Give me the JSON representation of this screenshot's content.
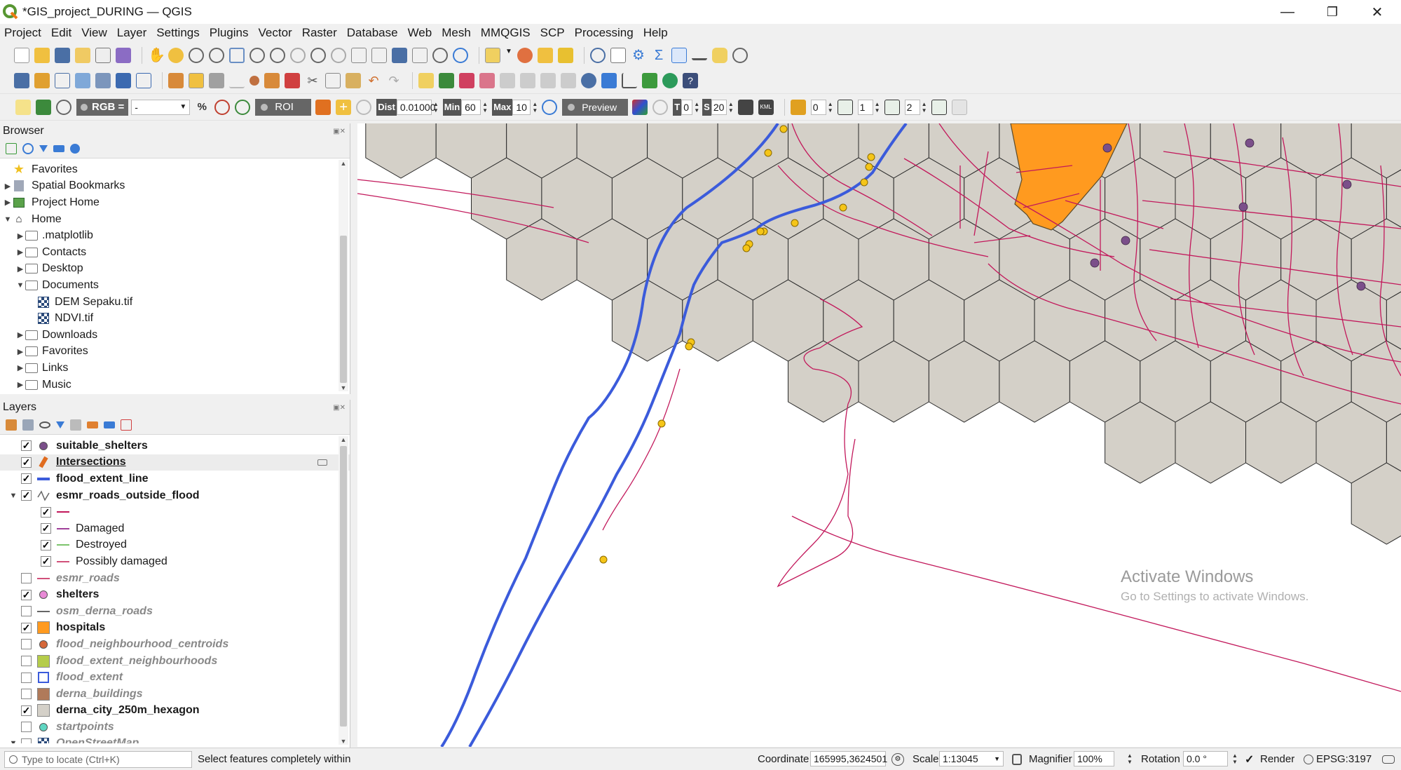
{
  "window": {
    "title": "*GIS_project_DURING — QGIS",
    "minimize": "—",
    "maximize": "❐",
    "close": "✕"
  },
  "menu": [
    "Project",
    "Edit",
    "View",
    "Layer",
    "Settings",
    "Plugins",
    "Vector",
    "Raster",
    "Database",
    "Web",
    "Mesh",
    "MMQGIS",
    "SCP",
    "Processing",
    "Help"
  ],
  "scp_toolbar": {
    "rgb_label": "RGB =",
    "rgb_value": "-",
    "roi_label": "ROI",
    "dist_label": "Dist",
    "dist_value": "0.01000",
    "min_label": "Min",
    "min_value": "60",
    "max_label": "Max",
    "max_value": "10",
    "preview_label": "Preview",
    "t_label": "T",
    "t_value": "0",
    "s_label": "S",
    "s_value": "20",
    "band_values": [
      "0",
      "1",
      "2"
    ]
  },
  "browser": {
    "title": "Browser",
    "items": [
      {
        "label": "Favorites",
        "level": 0,
        "arrow": "",
        "icon": "star"
      },
      {
        "label": "Spatial Bookmarks",
        "level": 0,
        "arrow": "▶",
        "icon": "bookmark"
      },
      {
        "label": "Project Home",
        "level": 0,
        "arrow": "▶",
        "icon": "project-home"
      },
      {
        "label": "Home",
        "level": 0,
        "arrow": "▼",
        "icon": "home"
      },
      {
        "label": ".matplotlib",
        "level": 1,
        "arrow": "▶",
        "icon": "folder"
      },
      {
        "label": "Contacts",
        "level": 1,
        "arrow": "▶",
        "icon": "folder"
      },
      {
        "label": "Desktop",
        "level": 1,
        "arrow": "▶",
        "icon": "folder"
      },
      {
        "label": "Documents",
        "level": 1,
        "arrow": "▼",
        "icon": "folder"
      },
      {
        "label": "DEM Sepaku.tif",
        "level": 2,
        "arrow": "",
        "icon": "raster"
      },
      {
        "label": "NDVI.tif",
        "level": 2,
        "arrow": "",
        "icon": "raster"
      },
      {
        "label": "Downloads",
        "level": 1,
        "arrow": "▶",
        "icon": "folder"
      },
      {
        "label": "Favorites",
        "level": 1,
        "arrow": "▶",
        "icon": "folder"
      },
      {
        "label": "Links",
        "level": 1,
        "arrow": "▶",
        "icon": "folder"
      },
      {
        "label": "Music",
        "level": 1,
        "arrow": "▶",
        "icon": "folder"
      }
    ]
  },
  "layers": {
    "title": "Layers",
    "items": [
      {
        "label": "suitable_shelters",
        "checked": true,
        "style": "bold",
        "symbol": "dot",
        "color": "#7b4f8a",
        "level": 0,
        "arrow": ""
      },
      {
        "label": "Intersections",
        "checked": true,
        "style": "bold-underline",
        "symbol": "brush",
        "color": "#e06c1f",
        "level": 0,
        "arrow": ""
      },
      {
        "label": "flood_extent_line",
        "checked": true,
        "style": "bold",
        "symbol": "line",
        "color": "#3b5bdb",
        "level": 0,
        "arrow": ""
      },
      {
        "label": "esmr_roads_outside_flood",
        "checked": true,
        "style": "bold",
        "symbol": "linestring",
        "color": "#777777",
        "level": 0,
        "arrow": "▼"
      },
      {
        "label": "",
        "checked": true,
        "style": "normal",
        "symbol": "line",
        "color": "#c2185b",
        "level": 1,
        "arrow": ""
      },
      {
        "label": "Damaged",
        "checked": true,
        "style": "normal",
        "symbol": "line",
        "color": "#a0409a",
        "level": 1,
        "arrow": ""
      },
      {
        "label": "Destroyed",
        "checked": true,
        "style": "normal",
        "symbol": "line",
        "color": "#7cc46c",
        "level": 1,
        "arrow": ""
      },
      {
        "label": "Possibly damaged",
        "checked": true,
        "style": "normal",
        "symbol": "line",
        "color": "#d1507a",
        "level": 1,
        "arrow": ""
      },
      {
        "label": "esmr_roads",
        "checked": false,
        "style": "off",
        "symbol": "line",
        "color": "#d1507a",
        "level": 0,
        "arrow": ""
      },
      {
        "label": "shelters",
        "checked": true,
        "style": "bold",
        "symbol": "dot",
        "color": "#e88ad6",
        "level": 0,
        "arrow": ""
      },
      {
        "label": "osm_derna_roads",
        "checked": false,
        "style": "off",
        "symbol": "line",
        "color": "#666666",
        "level": 0,
        "arrow": ""
      },
      {
        "label": "hospitals",
        "checked": true,
        "style": "bold",
        "symbol": "fill",
        "color": "#ff9a1f",
        "level": 0,
        "arrow": ""
      },
      {
        "label": "flood_neighbourhood_centroids",
        "checked": false,
        "style": "off",
        "symbol": "dot",
        "color": "#d6683a",
        "level": 0,
        "arrow": ""
      },
      {
        "label": "flood_extent_neighbourhoods",
        "checked": false,
        "style": "off",
        "symbol": "fill",
        "color": "#b5cc4a",
        "level": 0,
        "arrow": ""
      },
      {
        "label": "flood_extent",
        "checked": false,
        "style": "off",
        "symbol": "outline",
        "color": "#3b5bdb",
        "level": 0,
        "arrow": ""
      },
      {
        "label": "derna_buildings",
        "checked": false,
        "style": "off",
        "symbol": "fill",
        "color": "#b07a5a",
        "level": 0,
        "arrow": ""
      },
      {
        "label": "derna_city_250m_hexagon",
        "checked": true,
        "style": "bold",
        "symbol": "fill",
        "color": "#d4d0c8",
        "level": 0,
        "arrow": ""
      },
      {
        "label": "startpoints",
        "checked": false,
        "style": "off",
        "symbol": "dot",
        "color": "#5fd6c2",
        "level": 0,
        "arrow": ""
      },
      {
        "label": "OpenStreetMap",
        "checked": false,
        "style": "off",
        "symbol": "raster",
        "color": "#2b4a7a",
        "level": 0,
        "arrow": "▼"
      }
    ]
  },
  "map": {
    "watermark_title": "Activate Windows",
    "watermark_sub": "Go to Settings to activate Windows.",
    "hex_fill": "#d4d0c8",
    "road_color": "#c2185b",
    "flood_line_color": "#3b5bdb",
    "hospital_color": "#ff9a1f",
    "shelter_color": "#7b4f8a",
    "intersection_color": "#f5c518"
  },
  "status": {
    "locate_placeholder": "Type to locate (Ctrl+K)",
    "message": "Select features completely within",
    "coordinate_label": "Coordinate",
    "coordinate_value": "165995,3624501",
    "scale_label": "Scale",
    "scale_value": "1:13045",
    "magnifier_label": "Magnifier",
    "magnifier_value": "100%",
    "rotation_label": "Rotation",
    "rotation_value": "0.0 °",
    "render_label": "Render",
    "crs_label": "EPSG:3197"
  }
}
